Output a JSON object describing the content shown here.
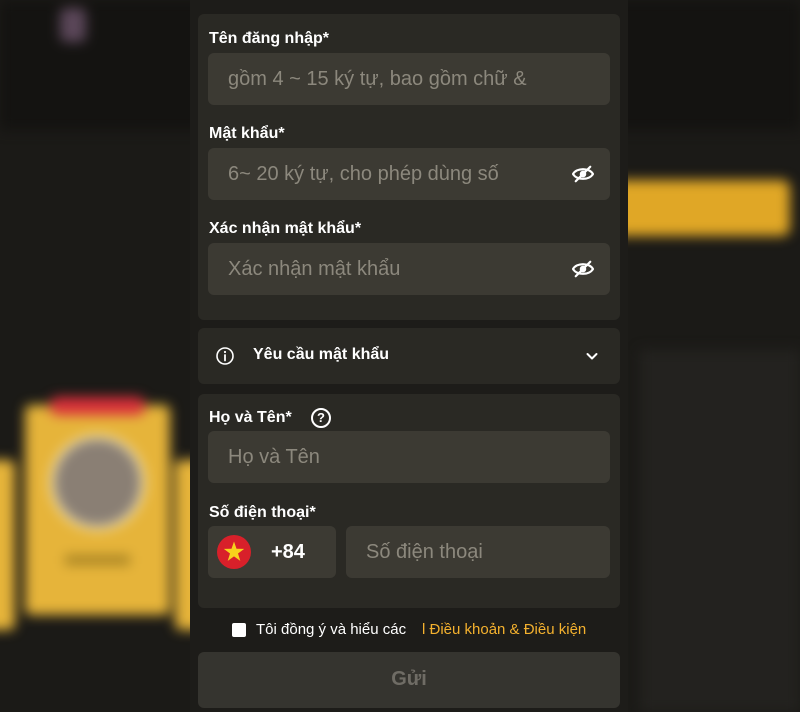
{
  "form": {
    "username": {
      "label": "Tên đăng nhập*",
      "placeholder": "gồm 4 ~ 15 ký tự, bao gồm chữ &"
    },
    "password": {
      "label": "Mật khẩu*",
      "placeholder": "6~ 20 ký tự, cho phép dùng số"
    },
    "confirm_password": {
      "label": "Xác nhận mật khẩu*",
      "placeholder": "Xác nhận mật khẩu"
    },
    "password_requirements": {
      "label": "Yêu cầu mật khẩu"
    },
    "full_name": {
      "label": "Họ và Tên*",
      "help": "?",
      "placeholder": "Họ và Tên"
    },
    "phone": {
      "label": "Số điện thoại*",
      "country_code": "+84",
      "placeholder": "Số điện thoại"
    },
    "agreement": {
      "text": "Tôi đồng ý và hiểu các",
      "link": "l Điều khoản & Điều kiện"
    },
    "submit_label": "Gửi"
  },
  "colors": {
    "accent": "#f4b12e",
    "panel_bg": "#2a2924",
    "input_bg": "#3c3a33"
  },
  "icons": [
    "eye-off-icon",
    "info-icon",
    "chevron-down-icon",
    "help-icon",
    "vietnam-flag-icon"
  ]
}
